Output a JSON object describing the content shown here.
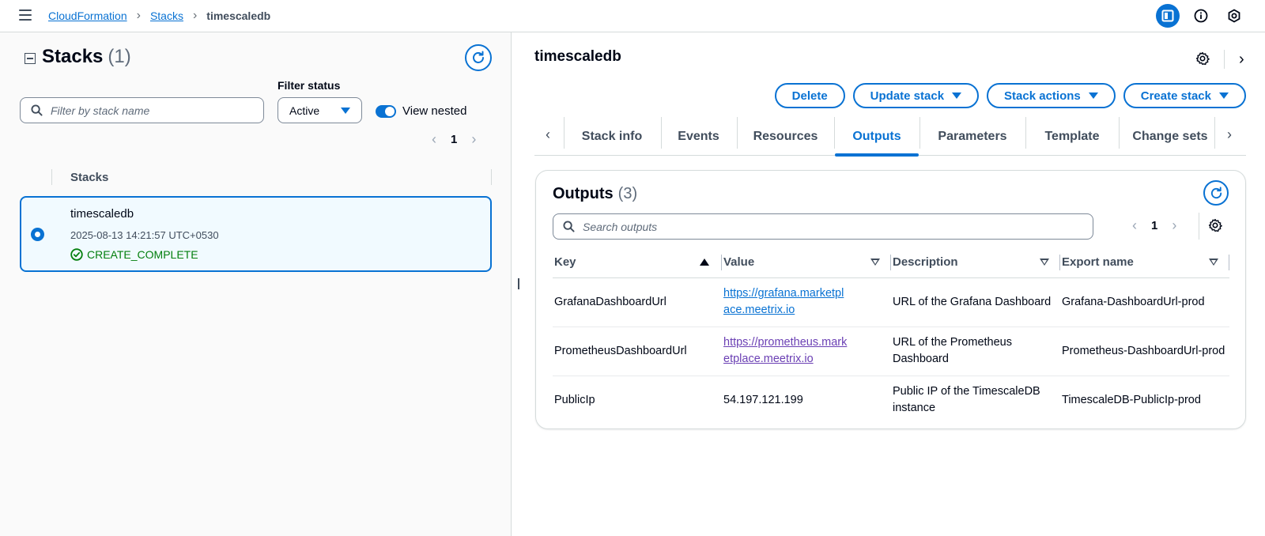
{
  "breadcrumb": {
    "root": "CloudFormation",
    "stacks": "Stacks",
    "current": "timescaledb"
  },
  "colors": {
    "accent": "#0972d3",
    "success": "#037f0c",
    "selected_bg": "#f1faff"
  },
  "left": {
    "title": "Stacks",
    "count": "(1)",
    "search_placeholder": "Filter by stack name",
    "filter_label": "Filter status",
    "filter_value": "Active",
    "toggle_label": "View nested",
    "toggle_on": true,
    "page": "1",
    "column_header": "Stacks",
    "stack": {
      "name": "timescaledb",
      "created": "2025-08-13 14:21:57 UTC+0530",
      "status": "CREATE_COMPLETE"
    }
  },
  "right": {
    "title": "timescaledb",
    "actions": {
      "delete": "Delete",
      "update": "Update stack",
      "stack_actions": "Stack actions",
      "create": "Create stack"
    },
    "tabs": [
      "Stack info",
      "Events",
      "Resources",
      "Outputs",
      "Parameters",
      "Template",
      "Change sets"
    ],
    "active_tab": "Outputs",
    "outputs": {
      "title": "Outputs",
      "count": "(3)",
      "search_placeholder": "Search outputs",
      "page": "1",
      "columns": [
        "Key",
        "Value",
        "Description",
        "Export name"
      ],
      "rows": [
        {
          "key": "GrafanaDashboardUrl",
          "value": "https://grafana.marketplace.meetrix.io",
          "value_l1": "https://grafana.marketpl",
          "value_l2": "ace.meetrix.io",
          "description": "URL of the Grafana Dashboard",
          "export": "Grafana-DashboardUrl-prod"
        },
        {
          "key": "PrometheusDashboardUrl",
          "value": "https://prometheus.marketplace.meetrix.io",
          "value_l1": "https://prometheus.mark",
          "value_l2": "etplace.meetrix.io",
          "description": "URL of the Prometheus Dashboard",
          "export": "Prometheus-DashboardUrl-prod"
        },
        {
          "key": "PublicIp",
          "value": "54.197.121.199",
          "description": "Public IP of the TimescaleDB instance",
          "export": "TimescaleDB-PublicIp-prod"
        }
      ]
    }
  }
}
